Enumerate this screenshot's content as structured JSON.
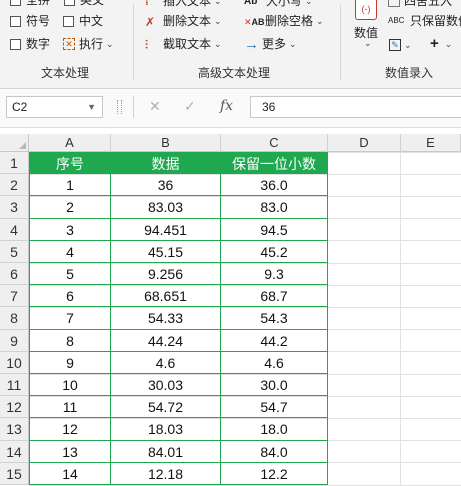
{
  "ribbon": {
    "text_group": {
      "row1a": "全拼",
      "row1b": "英文",
      "symbol": "符号",
      "chinese": "中文",
      "number": "数字",
      "execute": "执行",
      "label": "文本处理"
    },
    "adv_group": {
      "insert_text": "插入文本",
      "case": "大小写",
      "delete_text": "删除文本",
      "delete_space": "删除空格",
      "extract_text": "截取文本",
      "more": "更多",
      "label": "高级文本处理"
    },
    "num_group": {
      "round": "四舍五入",
      "value": "数值",
      "keep_value": "只保留数值",
      "label": "数值录入"
    }
  },
  "formula_bar": {
    "cell_ref": "C2",
    "fx": "fx",
    "value": "36"
  },
  "columns": [
    "A",
    "B",
    "C",
    "D",
    "E"
  ],
  "header_row": [
    "序号",
    "数据",
    "保留一位小数"
  ],
  "rows": [
    [
      "1",
      "36",
      "36.0"
    ],
    [
      "2",
      "83.03",
      "83.0"
    ],
    [
      "3",
      "94.451",
      "94.5"
    ],
    [
      "4",
      "45.15",
      "45.2"
    ],
    [
      "5",
      "9.256",
      "9.3"
    ],
    [
      "6",
      "68.651",
      "68.7"
    ],
    [
      "7",
      "54.33",
      "54.3"
    ],
    [
      "8",
      "44.24",
      "44.2"
    ],
    [
      "9",
      "4.6",
      "4.6"
    ],
    [
      "10",
      "30.03",
      "30.0"
    ],
    [
      "11",
      "54.72",
      "54.7"
    ],
    [
      "12",
      "18.03",
      "18.0"
    ],
    [
      "13",
      "84.01",
      "84.0"
    ],
    [
      "14",
      "12.18",
      "12.2"
    ]
  ],
  "row_numbers": [
    "1",
    "2",
    "3",
    "4",
    "5",
    "6",
    "7",
    "8",
    "9",
    "10",
    "11",
    "12",
    "13",
    "14",
    "15"
  ],
  "colors": {
    "header_fill": "#1fa84f",
    "border": "#1fa84f",
    "red_icon": "#c0392b",
    "blue_icon": "#2b78c5"
  }
}
